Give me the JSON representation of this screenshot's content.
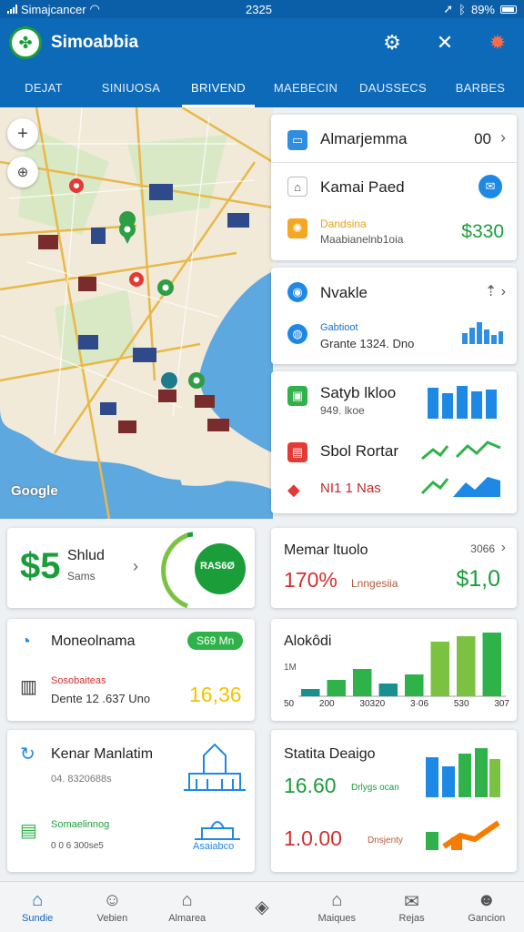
{
  "status_bar": {
    "carrier": "Simajcancer",
    "time": "2325",
    "battery": "89%"
  },
  "header": {
    "app_title": "Simoabbia",
    "icons": [
      "settings-icon",
      "tools-icon",
      "alert-icon"
    ]
  },
  "tabs": [
    {
      "label": "DEJAT",
      "active": false
    },
    {
      "label": "SINIUOSA",
      "active": false
    },
    {
      "label": "BRIVEND",
      "active": true
    },
    {
      "label": "MAEBECIN",
      "active": false
    },
    {
      "label": "DAUSSECS",
      "active": false
    },
    {
      "label": "BARBES",
      "active": false
    }
  ],
  "map": {
    "attribution": "Google"
  },
  "panel1": {
    "row1": {
      "label": "Almarjemma",
      "value": "00"
    },
    "row2": {
      "label": "Kamai Paed"
    },
    "row3": {
      "title": "Dandsina",
      "subtitle": "Maabianelnb1oia",
      "value": "$330"
    }
  },
  "panel2": {
    "row1": {
      "label": "Nvakle"
    },
    "row2": {
      "title": "Gabtioot",
      "subtitle": "Grante 1324. Dno"
    }
  },
  "panel3": {
    "row1": {
      "title": "Satyb lkloo",
      "subtitle": "949. lkoe"
    },
    "row2": {
      "label": "Sbol Rortar"
    },
    "row3": {
      "label": "NI1 1 Nas"
    }
  },
  "cards": {
    "stat": {
      "big": "$5",
      "title": "Shlud",
      "subtitle": "Sams",
      "badge": "RAS6Ø",
      "colors": {
        "accent": "#1b9e3a"
      }
    },
    "market": {
      "title": "Memar ltuolo",
      "ref": "3066",
      "percent": "170%",
      "sub": "Lnngesiia",
      "value": "$1,0"
    },
    "mone": {
      "title": "Moneolnama",
      "pill": "S69 Mn",
      "label": "Sosobaiteas",
      "sub": "Dente 12 .637 Uno",
      "value": "16,36"
    },
    "akoi": {
      "title": "Alokôdi",
      "yaxis": "1M",
      "xticks": [
        "50",
        "200",
        "30320",
        "3·06",
        "530",
        "307"
      ]
    },
    "kenar": {
      "title": "Kenar Manlatim",
      "line1": "04. 8320688s",
      "label2": "Somaelinnog",
      "line2": "0 0 6 300se5",
      "caption": "Asaiabco"
    },
    "statita": {
      "title": "Statita Deaigo",
      "value1": "16.60",
      "sub1": "Drlygs ocan",
      "value2": "1.0.00",
      "sub2": "Dnsjenty"
    }
  },
  "chart_data": {
    "type": "bar",
    "title": "Alokôdi",
    "categories": [
      "50",
      "200",
      "30320",
      "3·06",
      "530",
      "307"
    ],
    "series": [
      {
        "values": [
          8,
          18,
          30,
          14,
          24,
          60,
          66,
          70
        ]
      }
    ]
  },
  "bottom_nav": [
    {
      "label": "Sundie",
      "icon": "home-icon",
      "active": true
    },
    {
      "label": "Vebien",
      "icon": "person-icon",
      "active": false
    },
    {
      "label": "Almarea",
      "icon": "building-icon",
      "active": false
    },
    {
      "label": "",
      "icon": "compass-icon",
      "active": false
    },
    {
      "label": "Maiques",
      "icon": "house-icon",
      "active": false
    },
    {
      "label": "Rejas",
      "icon": "mail-icon",
      "active": false
    },
    {
      "label": "Gancion",
      "icon": "user-icon",
      "active": false
    }
  ]
}
